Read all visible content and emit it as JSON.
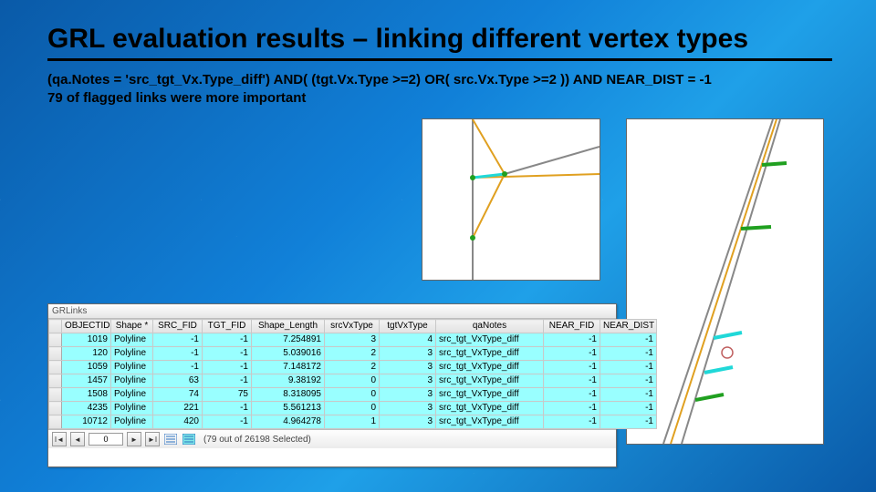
{
  "title": "GRL evaluation results – linking different vertex types",
  "subtitle_line1": "(qa.Notes = 'src_tgt_Vx.Type_diff') AND( (tgt.Vx.Type >=2) OR( src.Vx.Type >=2 )) AND NEAR_DIST =  -1",
  "subtitle_line2": "79 of flagged links were more important",
  "grid": {
    "window_title": "GRLinks",
    "columns": [
      "OBJECTID",
      "Shape *",
      "SRC_FID",
      "TGT_FID",
      "Shape_Length",
      "srcVxType",
      "tgtVxType",
      "qaNotes",
      "NEAR_FID",
      "NEAR_DIST"
    ],
    "rows": [
      {
        "OBJECTID": "1019",
        "Shape": "Polyline",
        "SRC_FID": "-1",
        "TGT_FID": "-1",
        "Shape_Length": "7.254891",
        "srcVxType": "3",
        "tgtVxType": "4",
        "qaNotes": "src_tgt_VxType_diff",
        "NEAR_FID": "-1",
        "NEAR_DIST": "-1"
      },
      {
        "OBJECTID": "120",
        "Shape": "Polyline",
        "SRC_FID": "-1",
        "TGT_FID": "-1",
        "Shape_Length": "5.039016",
        "srcVxType": "2",
        "tgtVxType": "3",
        "qaNotes": "src_tgt_VxType_diff",
        "NEAR_FID": "-1",
        "NEAR_DIST": "-1"
      },
      {
        "OBJECTID": "1059",
        "Shape": "Polyline",
        "SRC_FID": "-1",
        "TGT_FID": "-1",
        "Shape_Length": "7.148172",
        "srcVxType": "2",
        "tgtVxType": "3",
        "qaNotes": "src_tgt_VxType_diff",
        "NEAR_FID": "-1",
        "NEAR_DIST": "-1"
      },
      {
        "OBJECTID": "1457",
        "Shape": "Polyline",
        "SRC_FID": "63",
        "TGT_FID": "-1",
        "Shape_Length": "9.38192",
        "srcVxType": "0",
        "tgtVxType": "3",
        "qaNotes": "src_tgt_VxType_diff",
        "NEAR_FID": "-1",
        "NEAR_DIST": "-1"
      },
      {
        "OBJECTID": "1508",
        "Shape": "Polyline",
        "SRC_FID": "74",
        "TGT_FID": "75",
        "Shape_Length": "8.318095",
        "srcVxType": "0",
        "tgtVxType": "3",
        "qaNotes": "src_tgt_VxType_diff",
        "NEAR_FID": "-1",
        "NEAR_DIST": "-1"
      },
      {
        "OBJECTID": "4235",
        "Shape": "Polyline",
        "SRC_FID": "221",
        "TGT_FID": "-1",
        "Shape_Length": "5.561213",
        "srcVxType": "0",
        "tgtVxType": "3",
        "qaNotes": "src_tgt_VxType_diff",
        "NEAR_FID": "-1",
        "NEAR_DIST": "-1"
      },
      {
        "OBJECTID": "10712",
        "Shape": "Polyline",
        "SRC_FID": "420",
        "TGT_FID": "-1",
        "Shape_Length": "4.964278",
        "srcVxType": "1",
        "tgtVxType": "3",
        "qaNotes": "src_tgt_VxType_diff",
        "NEAR_FID": "-1",
        "NEAR_DIST": "-1"
      }
    ],
    "nav": {
      "first": "I◄",
      "prev": "◄",
      "record": "0",
      "next": "►",
      "last": "►I"
    },
    "status": "(79 out of 26198 Selected)"
  },
  "icons": {
    "list_all": "list-all-icon",
    "list_selected": "list-selected-icon"
  }
}
